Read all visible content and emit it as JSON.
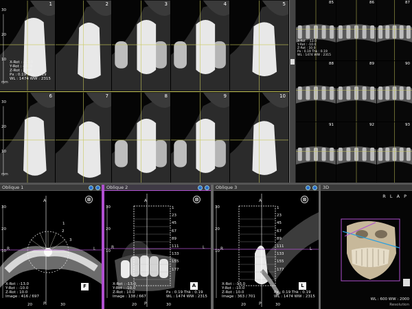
{
  "axial_panels": [
    {
      "number": "1",
      "ticks": [
        "30",
        "20",
        "10"
      ],
      "unit": "mm",
      "info": [
        "X-Rot : -13.0",
        "Y-Rot : -10.0",
        "Z-Rot : 10.0",
        "Px : 0.19 Thk : 0.19",
        "WL : 1474 WW : 2315"
      ]
    },
    {
      "number": "2"
    },
    {
      "number": "3"
    },
    {
      "number": "4"
    },
    {
      "number": "5"
    },
    {
      "number": "6",
      "ticks": [
        "30",
        "20",
        "10"
      ],
      "unit": "mm"
    },
    {
      "number": "7"
    },
    {
      "number": "8"
    },
    {
      "number": "9"
    },
    {
      "number": "10"
    }
  ],
  "thumbs": [
    {
      "number": "85",
      "info": [
        "X-Rot : -13.0",
        "Y-Rot : -10.0",
        "Z-Rot : 10.0",
        "Px : 0.19 Thk : 0.19",
        "WL : 1474 WW : 2315"
      ]
    },
    {
      "number": "86"
    },
    {
      "number": "87"
    },
    {
      "number": "88"
    },
    {
      "number": "89"
    },
    {
      "number": "90"
    },
    {
      "number": "91"
    },
    {
      "number": "92"
    },
    {
      "number": "93"
    }
  ],
  "oblique1": {
    "title": "Oblique 1",
    "labels": {
      "a": "A",
      "p": "P",
      "r": "R",
      "l": "L"
    },
    "arc_labels": [
      "1",
      "2",
      "3"
    ],
    "ticks": [
      "30",
      "20",
      "10"
    ],
    "bottom_ticks": [
      "20",
      "30"
    ],
    "info": [
      "X-Rot : -13.0",
      "Y-Rot : -10.0",
      "Z-Rot : 10.0",
      "Image : 416 / 697"
    ],
    "badge": "F",
    "nav_icon": "⊗"
  },
  "oblique2": {
    "title": "Oblique 2",
    "labels": {
      "a": "A",
      "p": "P",
      "r": "R",
      "l": "L"
    },
    "slice_labels": [
      "1",
      "23",
      "45",
      "67",
      "89",
      "111",
      "133",
      "155",
      "177"
    ],
    "ticks": [
      "30",
      "20",
      "10"
    ],
    "bottom_ticks": [
      "20",
      "30"
    ],
    "info": [
      "X-Rot : -13.0",
      "Y-Rot : -10.0",
      "Z-Rot : 10.0",
      "Image : 138 / 667"
    ],
    "info_right": [
      "Px : 0.19 Thk : 0.19",
      "WL : 1474 WW : 2315"
    ],
    "badge": "A",
    "nav_icon": "⊗"
  },
  "oblique3": {
    "title": "Oblique 3",
    "labels": {
      "a": "A",
      "p": "P",
      "r": "R",
      "l": "L"
    },
    "slice_labels": [
      "1",
      "23",
      "45",
      "67",
      "89",
      "111",
      "133",
      "155",
      "177"
    ],
    "ticks": [
      "30",
      "20",
      "10"
    ],
    "bottom_ticks": [
      "20",
      "30"
    ],
    "info": [
      "X-Rot : -13.0",
      "Y-Rot : -10.0",
      "Z-Rot : 10.0",
      "Image : 363 / 701"
    ],
    "info_right": [
      "Px : 0.19 Thk : 0.19",
      "WL : 1474 WW : 2315"
    ],
    "badge": "L",
    "nav_icon": "⊗"
  },
  "view3d": {
    "title": "3D",
    "orient": "R L A P",
    "wl": "WL : 600 WW : 2000",
    "resolution": "Resolution"
  },
  "colors": {
    "crosshair": "#c8c85a",
    "accent": "#b04fd0",
    "button": "#2a6fd0",
    "bg": "#000000"
  }
}
